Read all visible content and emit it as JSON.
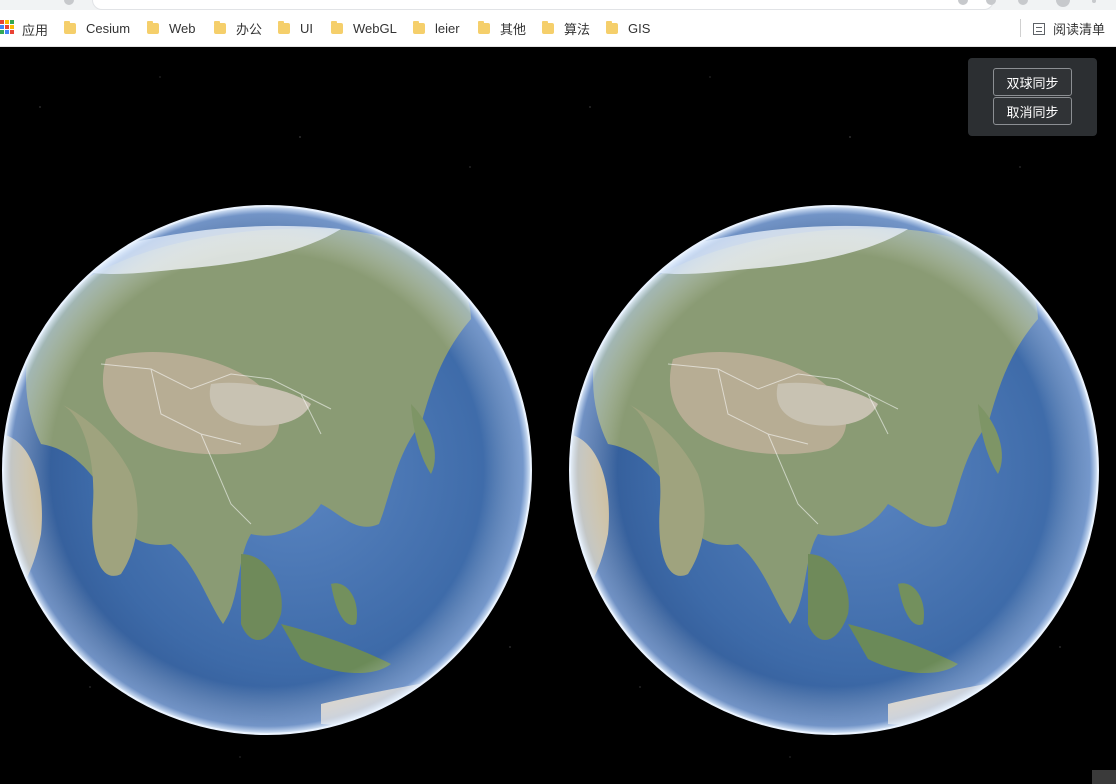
{
  "bookmarks": {
    "apps_label": "应用",
    "items": [
      {
        "label": "Cesium"
      },
      {
        "label": "Web"
      },
      {
        "label": "办公"
      },
      {
        "label": "UI"
      },
      {
        "label": "WebGL"
      },
      {
        "label": "leier"
      },
      {
        "label": "其他"
      },
      {
        "label": "算法"
      },
      {
        "label": "GIS"
      }
    ],
    "reading_list": "阅读清单"
  },
  "sync_panel": {
    "sync_button": "双球同步",
    "cancel_button": "取消同步"
  },
  "colors": {
    "panel_bg": "#303336",
    "button_border": "#8c8f93",
    "folder": "#f5cf6b",
    "ocean": "#3d6aa8",
    "land": "#8f9f7a"
  }
}
